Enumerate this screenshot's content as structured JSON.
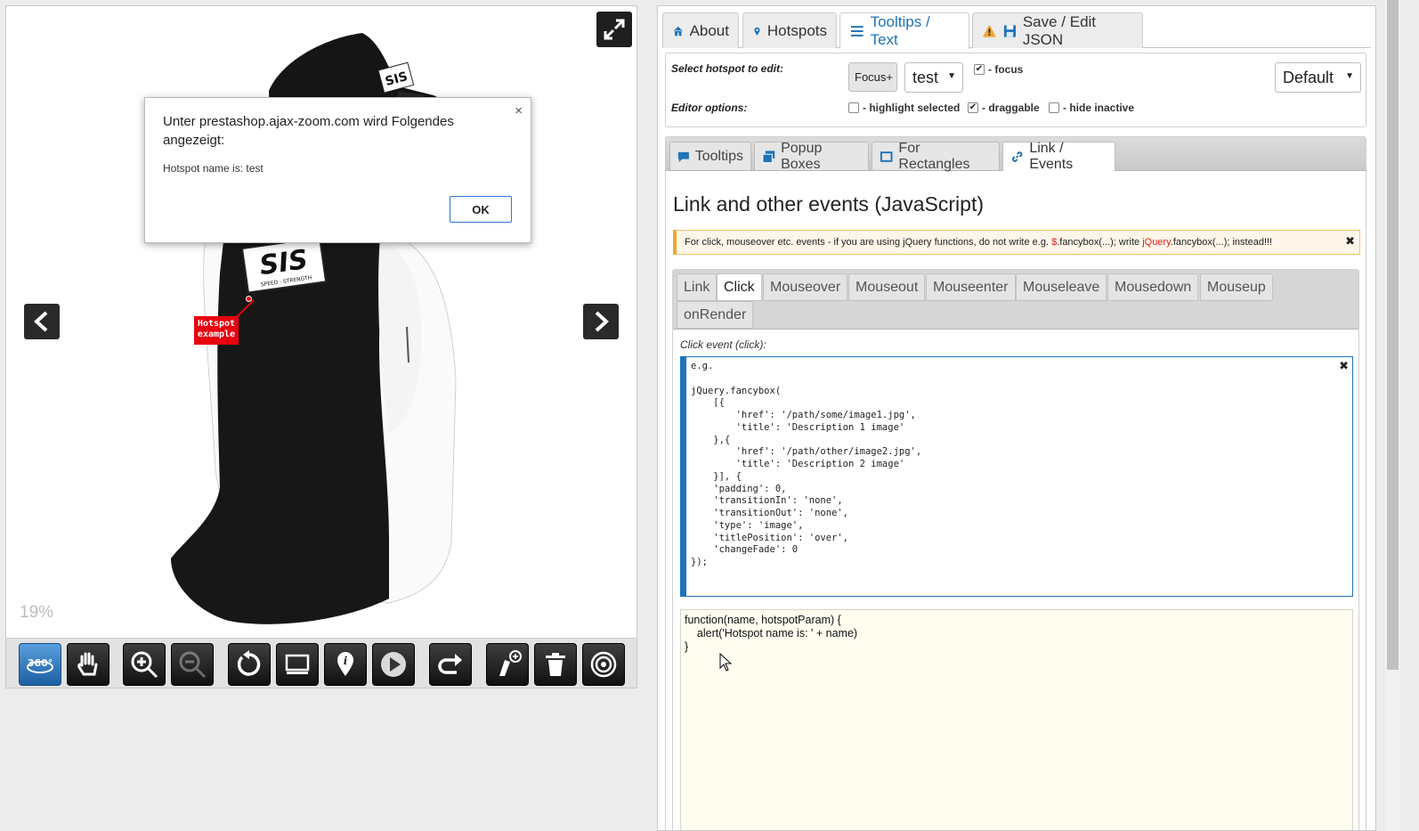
{
  "viewer": {
    "hotspot_label": "Hotspot example",
    "zoom_level": "19%",
    "toolbar": [
      {
        "icon": "360-icon",
        "active": true
      },
      {
        "icon": "hand-pan-icon"
      },
      {
        "icon": "zoom-in-icon"
      },
      {
        "icon": "zoom-out-icon",
        "disabled": true
      },
      {
        "icon": "reset-icon"
      },
      {
        "icon": "gallery-icon"
      },
      {
        "icon": "hotspot-info-icon"
      },
      {
        "icon": "play-icon"
      },
      {
        "icon": "redo-icon"
      },
      {
        "icon": "add-hotspot-icon"
      },
      {
        "icon": "trash-icon"
      },
      {
        "icon": "target-icon"
      }
    ]
  },
  "alert": {
    "title": "Unter prestashop.ajax-zoom.com wird Folgendes angezeigt:",
    "message": "Hotspot name is: test",
    "ok_label": "OK",
    "close": "×"
  },
  "panel": {
    "main_tabs": [
      {
        "label": "About",
        "icon": "home-icon"
      },
      {
        "label": "Hotspots",
        "icon": "map-marker-icon"
      },
      {
        "label": "Tooltips / Text",
        "icon": "list-icon",
        "active": true
      },
      {
        "label": "Save / Edit JSON",
        "icon": "save-icon"
      }
    ],
    "editor": {
      "select_label": "Select hotspot to edit:",
      "focus_button": "Focus+",
      "hotspot_value": "test",
      "focus_check": "- focus",
      "mode_value": "Default",
      "options_label": "Editor options:",
      "highlight_selected": "- highlight selected",
      "draggable": "- draggable",
      "hide_inactive": "- hide inactive"
    },
    "sub_tabs": [
      {
        "label": "Tooltips",
        "icon": "comment-icon"
      },
      {
        "label": "Popup Boxes",
        "icon": "popup-icon"
      },
      {
        "label": "For Rectangles",
        "icon": "rectangle-icon"
      },
      {
        "label": "Link / Events",
        "icon": "link-icon",
        "active": true
      }
    ],
    "section_title": "Link and other events (JavaScript)",
    "warning": {
      "text_before": "For click, mouseover etc. events - if you are using jQuery functions, do not write e.g. ",
      "bad": "$",
      "text_mid": ".fancybox(...); write ",
      "good": "jQuery",
      "text_after": ".fancybox(...); instead!!!"
    },
    "event_tabs": [
      "Link",
      "Click",
      "Mouseover",
      "Mouseout",
      "Mouseenter",
      "Mouseleave",
      "Mousedown",
      "Mouseup",
      "onRender"
    ],
    "active_event": "Click",
    "click_label": "Click event (click):",
    "example_code": "e.g.\n\njQuery.fancybox(\n    [{\n        'href': '/path/some/image1.jpg',\n        'title': 'Description 1 image'\n    },{\n        'href': '/path/other/image2.jpg',\n        'title': 'Description 2 image'\n    }], {\n    'padding': 0,\n    'transitionIn': 'none',\n    'transitionOut': 'none',\n    'type': 'image',\n    'titlePosition': 'over',\n    'changeFade': 0\n});",
    "function_code": "function(name, hotspotParam) {\n    alert('Hotspot name is: ' + name)\n}"
  }
}
